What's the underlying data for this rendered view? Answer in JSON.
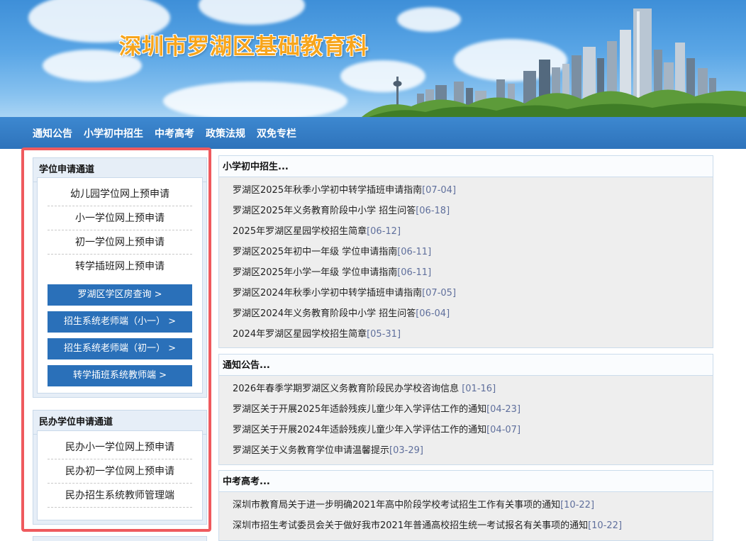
{
  "site": {
    "title": "深圳市罗湖区基础教育科"
  },
  "nav": {
    "items": [
      {
        "label": "通知公告"
      },
      {
        "label": "小学初中招生"
      },
      {
        "label": "中考高考"
      },
      {
        "label": "政策法规"
      },
      {
        "label": "双免专栏"
      }
    ]
  },
  "left": {
    "degree_panel": {
      "title": "学位申请通道",
      "links": [
        {
          "label": "幼儿园学位网上预申请"
        },
        {
          "label": "小一学位网上预申请"
        },
        {
          "label": "初一学位网上预申请"
        },
        {
          "label": "转学插班网上预申请"
        }
      ],
      "buttons": [
        {
          "label": "罗湖区学区房查询 >"
        },
        {
          "label": "招生系统老师端（小一） >"
        },
        {
          "label": "招生系统老师端（初一） >"
        },
        {
          "label": "转学插班系统教师端 >"
        }
      ]
    },
    "private_panel": {
      "title": "民办学位申请通道",
      "links": [
        {
          "label": "民办小一学位网上预申请"
        },
        {
          "label": "民办初一学位网上预申请"
        },
        {
          "label": "民办招生系统教师管理端"
        }
      ]
    }
  },
  "sections": {
    "admissions": {
      "title": "小学初中招生...",
      "items": [
        {
          "text": "罗湖区2025年秋季小学初中转学插班申请指南",
          "date": "[07-04]"
        },
        {
          "text": "罗湖区2025年义务教育阶段中小学 招生问答",
          "date": "[06-18]"
        },
        {
          "text": "2025年罗湖区星园学校招生简章",
          "date": "[06-12]"
        },
        {
          "text": "罗湖区2025年初中一年级 学位申请指南",
          "date": "[06-11]"
        },
        {
          "text": "罗湖区2025年小学一年级 学位申请指南",
          "date": "[06-11]"
        },
        {
          "text": "罗湖区2024年秋季小学初中转学插班申请指南",
          "date": "[07-05]"
        },
        {
          "text": "罗湖区2024年义务教育阶段中小学 招生问答",
          "date": "[06-04]"
        },
        {
          "text": "2024年罗湖区星园学校招生简章",
          "date": "[05-31]"
        }
      ]
    },
    "notices": {
      "title": "通知公告...",
      "items": [
        {
          "text": "2026年春季学期罗湖区义务教育阶段民办学校咨询信息 ",
          "date": "[01-16]"
        },
        {
          "text": "罗湖区关于开展2025年适龄残疾儿童少年入学评估工作的通知",
          "date": "[04-23]"
        },
        {
          "text": "罗湖区关于开展2024年适龄残疾儿童少年入学评估工作的通知",
          "date": "[04-07]"
        },
        {
          "text": "罗湖区关于义务教育学位申请温馨提示",
          "date": "[03-29]"
        }
      ]
    },
    "exams": {
      "title": "中考高考...",
      "items": [
        {
          "text": "深圳市教育局关于进一步明确2021年高中阶段学校考试招生工作有关事项的通知",
          "date": "[10-22]"
        },
        {
          "text": "深圳市招生考试委员会关于做好我市2021年普通高校招生统一考试报名有关事项的通知",
          "date": "[10-22]"
        }
      ]
    }
  },
  "colors": {
    "nav_bg": "#2e73bb",
    "button_bg": "#2a70b9",
    "title_orange": "#f7a51c",
    "highlight_red": "#ef5a5e",
    "date_color": "#5f6f9c"
  }
}
